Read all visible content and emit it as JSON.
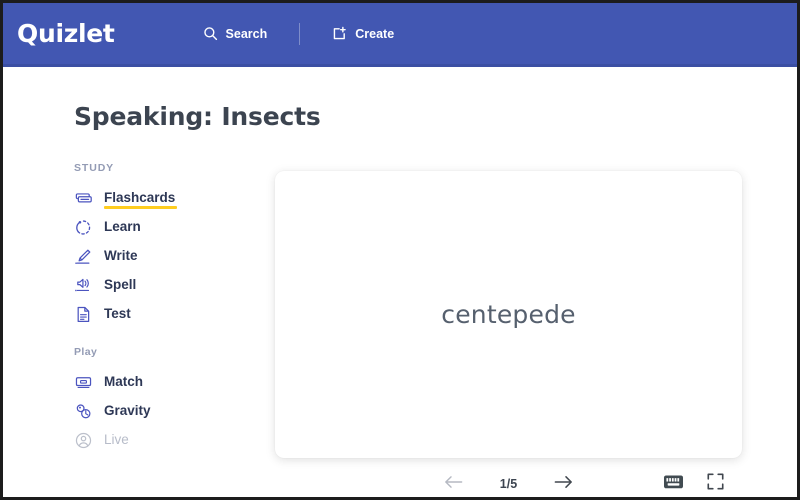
{
  "header": {
    "logo": "Quizlet",
    "brand_color": "#4257b2",
    "nav": [
      {
        "label": "Search",
        "icon": "search-icon"
      },
      {
        "label": "Create",
        "icon": "create-icon"
      }
    ]
  },
  "main": {
    "title": "Speaking: Insects"
  },
  "sidebar": {
    "study_label": "STUDY",
    "play_label": "Play",
    "active_underline_color": "#ffcd1f",
    "study_items": [
      {
        "label": "Flashcards",
        "icon": "flashcards-icon",
        "active": true,
        "disabled": false
      },
      {
        "label": "Learn",
        "icon": "learn-icon",
        "active": false,
        "disabled": false
      },
      {
        "label": "Write",
        "icon": "write-icon",
        "active": false,
        "disabled": false
      },
      {
        "label": "Spell",
        "icon": "spell-icon",
        "active": false,
        "disabled": false
      },
      {
        "label": "Test",
        "icon": "test-icon",
        "active": false,
        "disabled": false
      }
    ],
    "play_items": [
      {
        "label": "Match",
        "icon": "match-icon",
        "active": false,
        "disabled": false
      },
      {
        "label": "Gravity",
        "icon": "gravity-icon",
        "active": false,
        "disabled": false
      },
      {
        "label": "Live",
        "icon": "live-icon",
        "active": false,
        "disabled": true
      }
    ]
  },
  "flashcard": {
    "term": "centepede"
  },
  "controls": {
    "prev_icon": "arrow-left-icon",
    "next_icon": "arrow-right-icon",
    "counter": "1/5",
    "current": 1,
    "total": 5,
    "keyboard_icon": "keyboard-icon",
    "fullscreen_icon": "fullscreen-icon"
  }
}
